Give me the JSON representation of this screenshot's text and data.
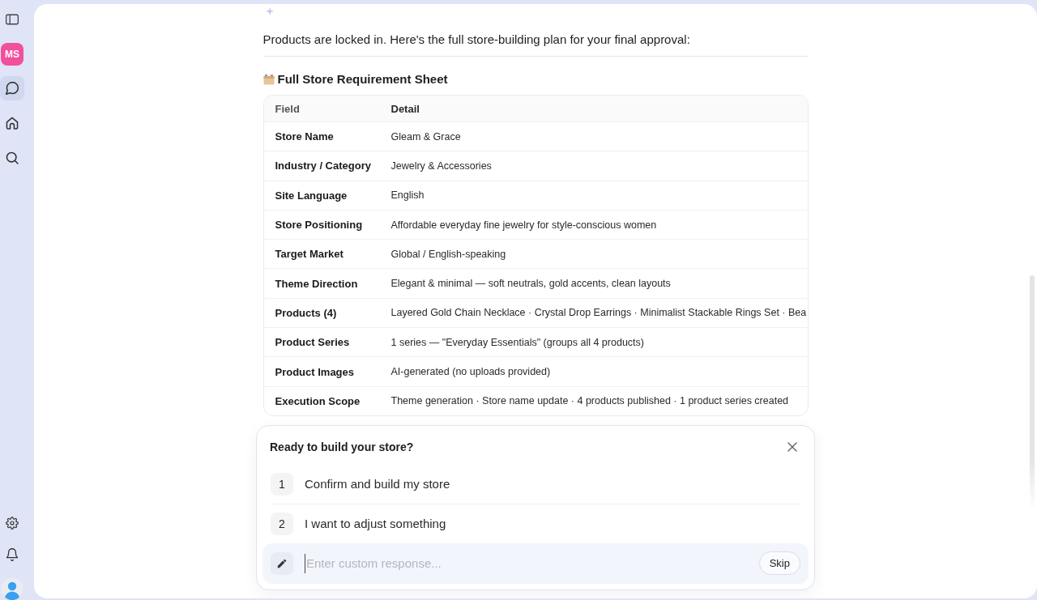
{
  "sidebar": {
    "avatar": {
      "initials": "MS"
    },
    "nav_items": [
      {
        "selected": true
      },
      {
        "selected": false
      },
      {
        "selected": false
      }
    ]
  },
  "message": {
    "intro": "Products are locked in. Here's the full store-building plan for your final approval:",
    "heading": "Full Store Requirement Sheet"
  },
  "table": {
    "columns": [
      "Field",
      "Detail"
    ],
    "rows": [
      {
        "field": "Store Name",
        "detail": "Gleam & Grace"
      },
      {
        "field": "Industry / Category",
        "detail": "Jewelry & Accessories"
      },
      {
        "field": "Site Language",
        "detail": "English"
      },
      {
        "field": "Store Positioning",
        "detail": "Affordable everyday fine jewelry for style-conscious women"
      },
      {
        "field": "Target Market",
        "detail": "Global / English-speaking"
      },
      {
        "field": "Theme Direction",
        "detail": "Elegant & minimal — soft neutrals, gold accents, clean layouts"
      },
      {
        "field": "Products (4)",
        "detail": "Layered Gold Chain Necklace · Crystal Drop Earrings · Minimalist Stackable Rings Set · Bea"
      },
      {
        "field": "Product Series",
        "detail": "1 series — \"Everyday Essentials\" (groups all 4 products)"
      },
      {
        "field": "Product Images",
        "detail": "AI-generated (no uploads provided)"
      },
      {
        "field": "Execution Scope",
        "detail": "Theme generation · Store name update · 4 products published · 1 product series created"
      }
    ]
  },
  "prompt": {
    "title": "Ready to build your store?",
    "options": [
      {
        "number": "1",
        "label": "Confirm and build my store"
      },
      {
        "number": "2",
        "label": "I want to adjust something"
      }
    ],
    "input": {
      "placeholder": "Enter custom response..."
    },
    "skip_button": "Skip"
  }
}
